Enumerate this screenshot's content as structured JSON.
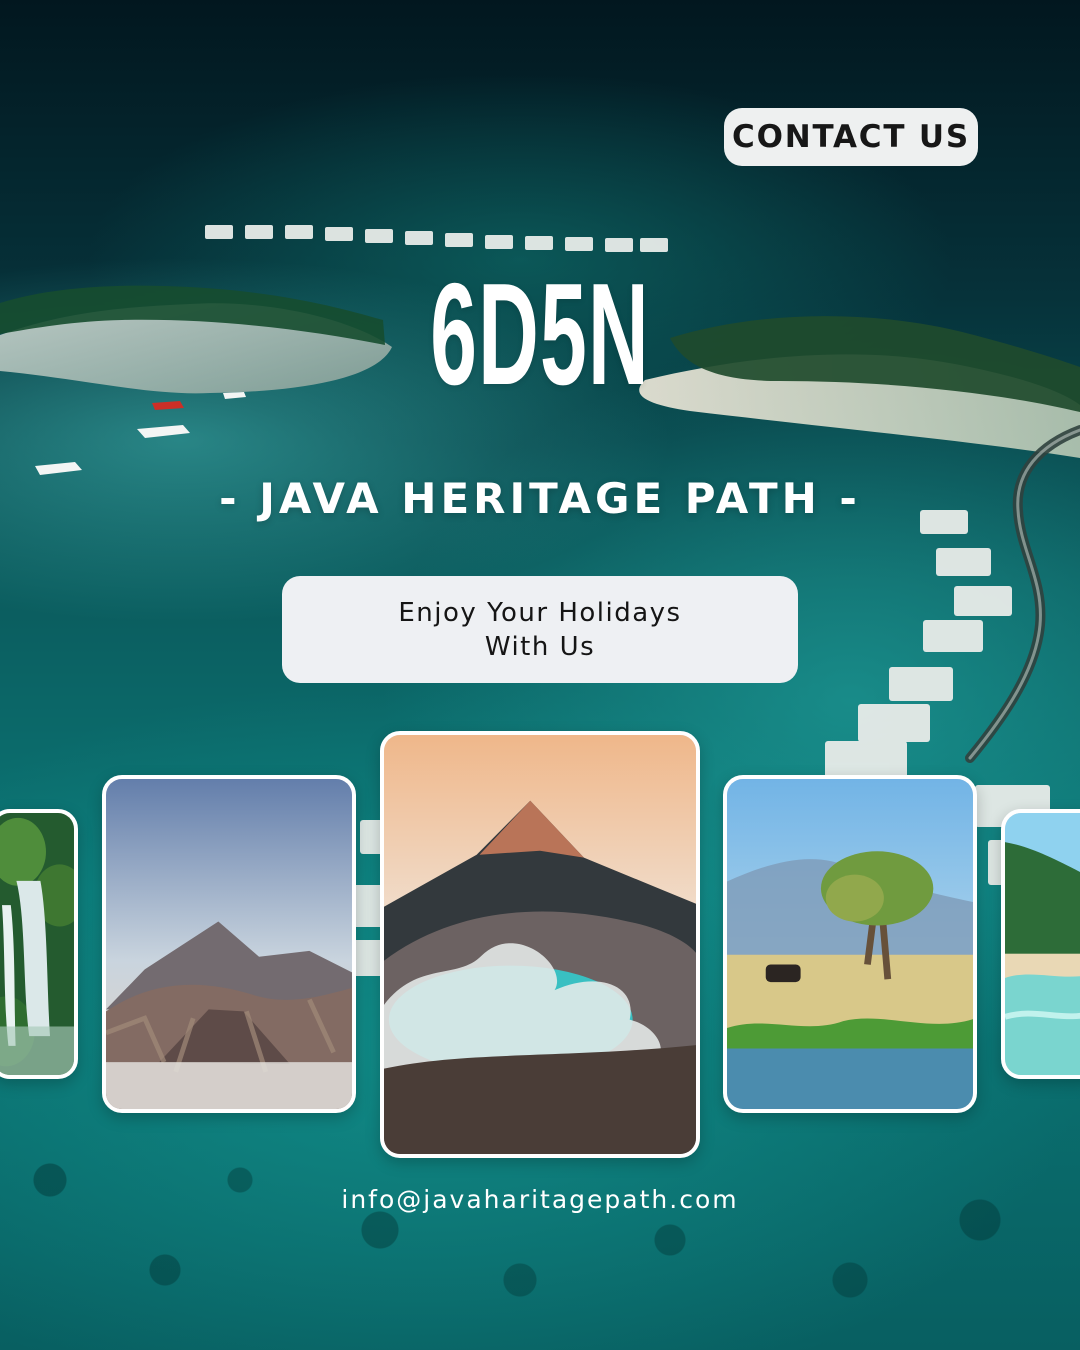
{
  "poster": {
    "contact_button": "CONTACT US",
    "duration": "6D5N",
    "tour_name": "- JAVA HERITAGE PATH -",
    "tagline_line_1": "Enjoy Your Holidays",
    "tagline_line_2": "With Us",
    "email": "info@javaharitagepath.com"
  },
  "colors": {
    "white": "#ffffff",
    "label_background": "#eef0f3",
    "dark_text": "#171717",
    "sea_dark": "#02171f",
    "sea_turquoise": "#0b7776"
  },
  "photo_cards": [
    {
      "icon": "waterfall-photo"
    },
    {
      "icon": "volcano-landscape-photo"
    },
    {
      "icon": "crater-lake-photo"
    },
    {
      "icon": "savanna-tree-photo"
    },
    {
      "icon": "tropical-beach-photo"
    }
  ]
}
